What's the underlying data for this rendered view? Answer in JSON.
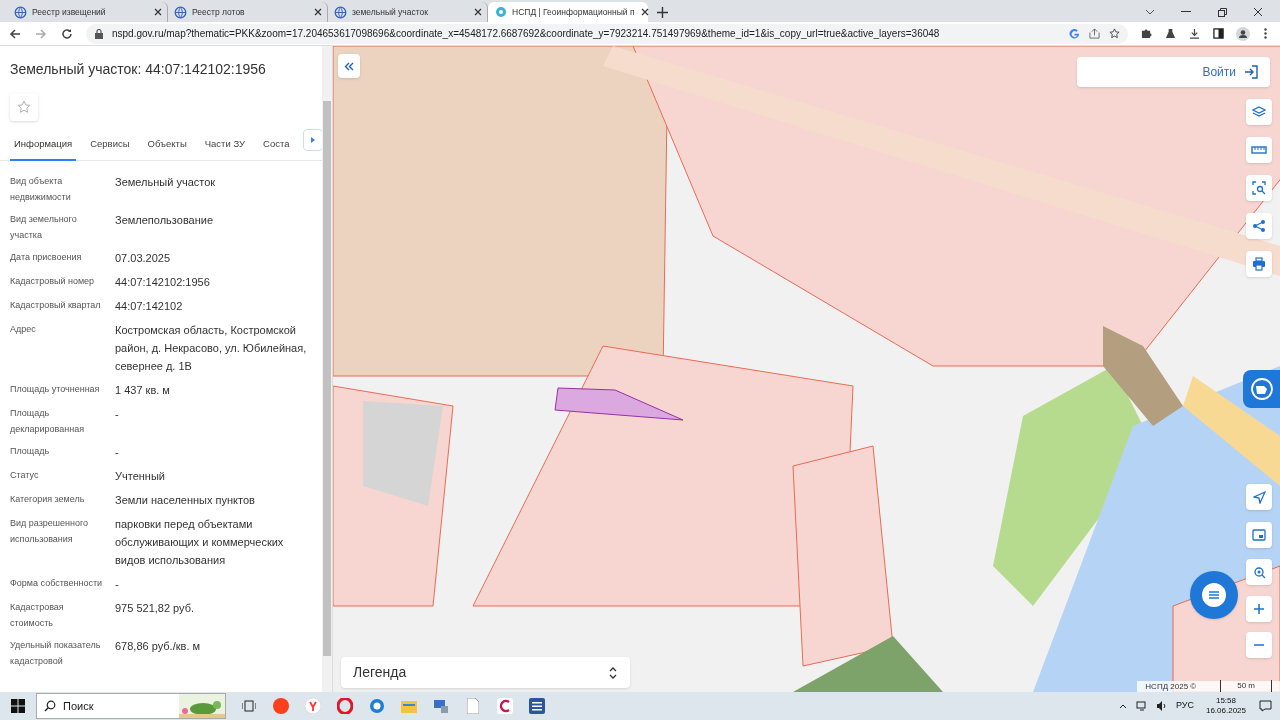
{
  "browser": {
    "tabs": [
      {
        "title": "Реестр извещений",
        "selected": false
      },
      {
        "title": "Реестр лотов",
        "selected": false
      },
      {
        "title": "земельный участок",
        "selected": false
      },
      {
        "title": "НСПД | Геоинформационный п",
        "selected": true
      }
    ],
    "url": "nspd.gov.ru/map?thematic=PKK&zoom=17.204653617098696&coordinate_x=4548172.6687692&coordinate_y=7923214.751497969&theme_id=1&is_copy_url=true&active_layers=36048"
  },
  "panel": {
    "title": "Земельный участок: 44:07:142102:1956",
    "tabs": [
      {
        "label": "Информация",
        "selected": true
      },
      {
        "label": "Сервисы",
        "selected": false
      },
      {
        "label": "Объекты",
        "selected": false
      },
      {
        "label": "Части ЗУ",
        "selected": false
      },
      {
        "label": "Соста",
        "selected": false
      }
    ],
    "fields": [
      {
        "label": "Вид объекта недвижимости",
        "value": "Земельный участок"
      },
      {
        "label": "Вид земельного участка",
        "value": "Землепользование"
      },
      {
        "label": "Дата присвоения",
        "value": "07.03.2025"
      },
      {
        "label": "Кадастровый номер",
        "value": "44:07:142102:1956"
      },
      {
        "label": "Кадастровый квартал",
        "value": "44:07:142102"
      },
      {
        "label": "Адрес",
        "value": "Костромская область, Костромской район, д. Некрасово, ул. Юбилейная, севернее д. 1В"
      },
      {
        "label": "Площадь уточненная",
        "value": "1 437 кв. м"
      },
      {
        "label": "Площадь декларированная",
        "value": "-"
      },
      {
        "label": "Площадь",
        "value": "-"
      },
      {
        "label": "Статус",
        "value": "Учтенный"
      },
      {
        "label": "Категория земель",
        "value": "Земли населенных пунктов"
      },
      {
        "label": "Вид разрешенного использования",
        "value": "парковки перед объектами обслуживающих и коммерческих видов использования"
      },
      {
        "label": "Форма собственности",
        "value": "-"
      },
      {
        "label": "Кадастровая стоимость",
        "value": "975 521,82 руб."
      },
      {
        "label": "Удельный показатель кадастровой",
        "value": "678,86 руб./кв. м"
      }
    ]
  },
  "map": {
    "login": "Войти",
    "legend": "Легенда",
    "attribution": "НСПД 2025 ©",
    "scale": "50 m"
  },
  "taskbar": {
    "search_placeholder": "Поиск",
    "language": "РУС",
    "time": "15:58",
    "date": "16.06.2025"
  }
}
